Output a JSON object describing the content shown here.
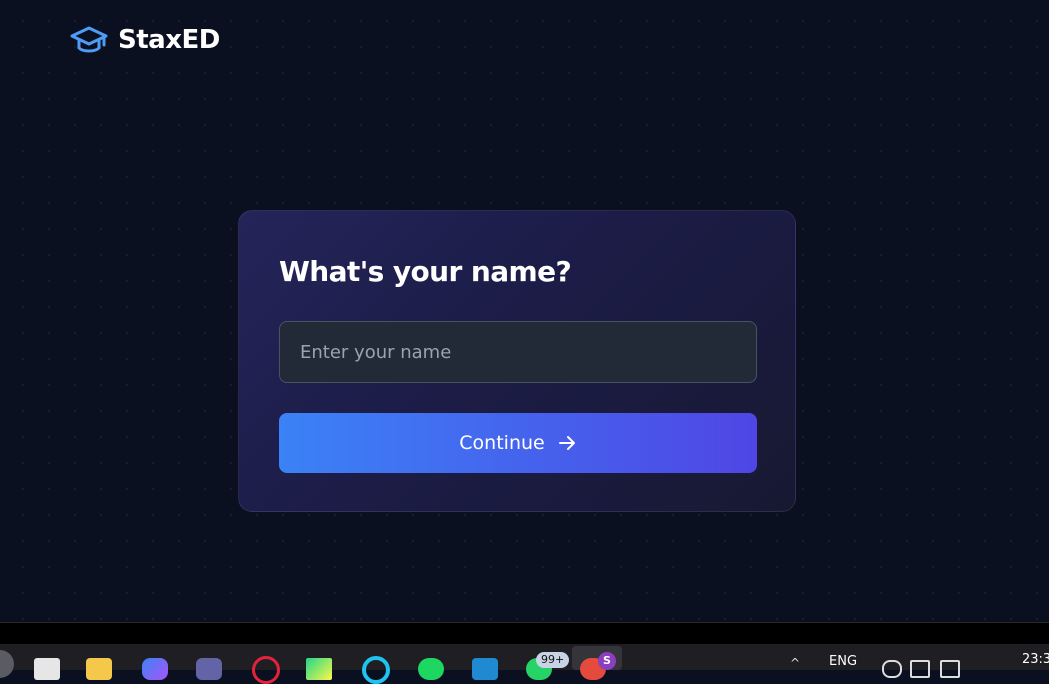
{
  "brand": {
    "name": "StaxED",
    "accent": "#4f9cf5"
  },
  "card": {
    "title": "What's your name?",
    "name_input": {
      "placeholder": "Enter your name",
      "value": ""
    },
    "continue_label": "Continue"
  },
  "taskbar": {
    "apps": [
      "start-icon",
      "notepad-icon",
      "file-explorer-icon",
      "copilot-icon",
      "teams-icon",
      "opera-icon",
      "pycharm-icon",
      "cortana-icon",
      "spotify-icon",
      "vscode-icon",
      "whatsapp-icon",
      "chrome-icon"
    ],
    "whatsapp_badge": "99+",
    "profile_badge": "S",
    "language": "ENG",
    "time": "23:3"
  },
  "colors": {
    "background": "#0b1021",
    "card_gradient_start": "#24245a",
    "button_gradient_start": "#3b82f6",
    "button_gradient_end": "#4f46e5"
  }
}
